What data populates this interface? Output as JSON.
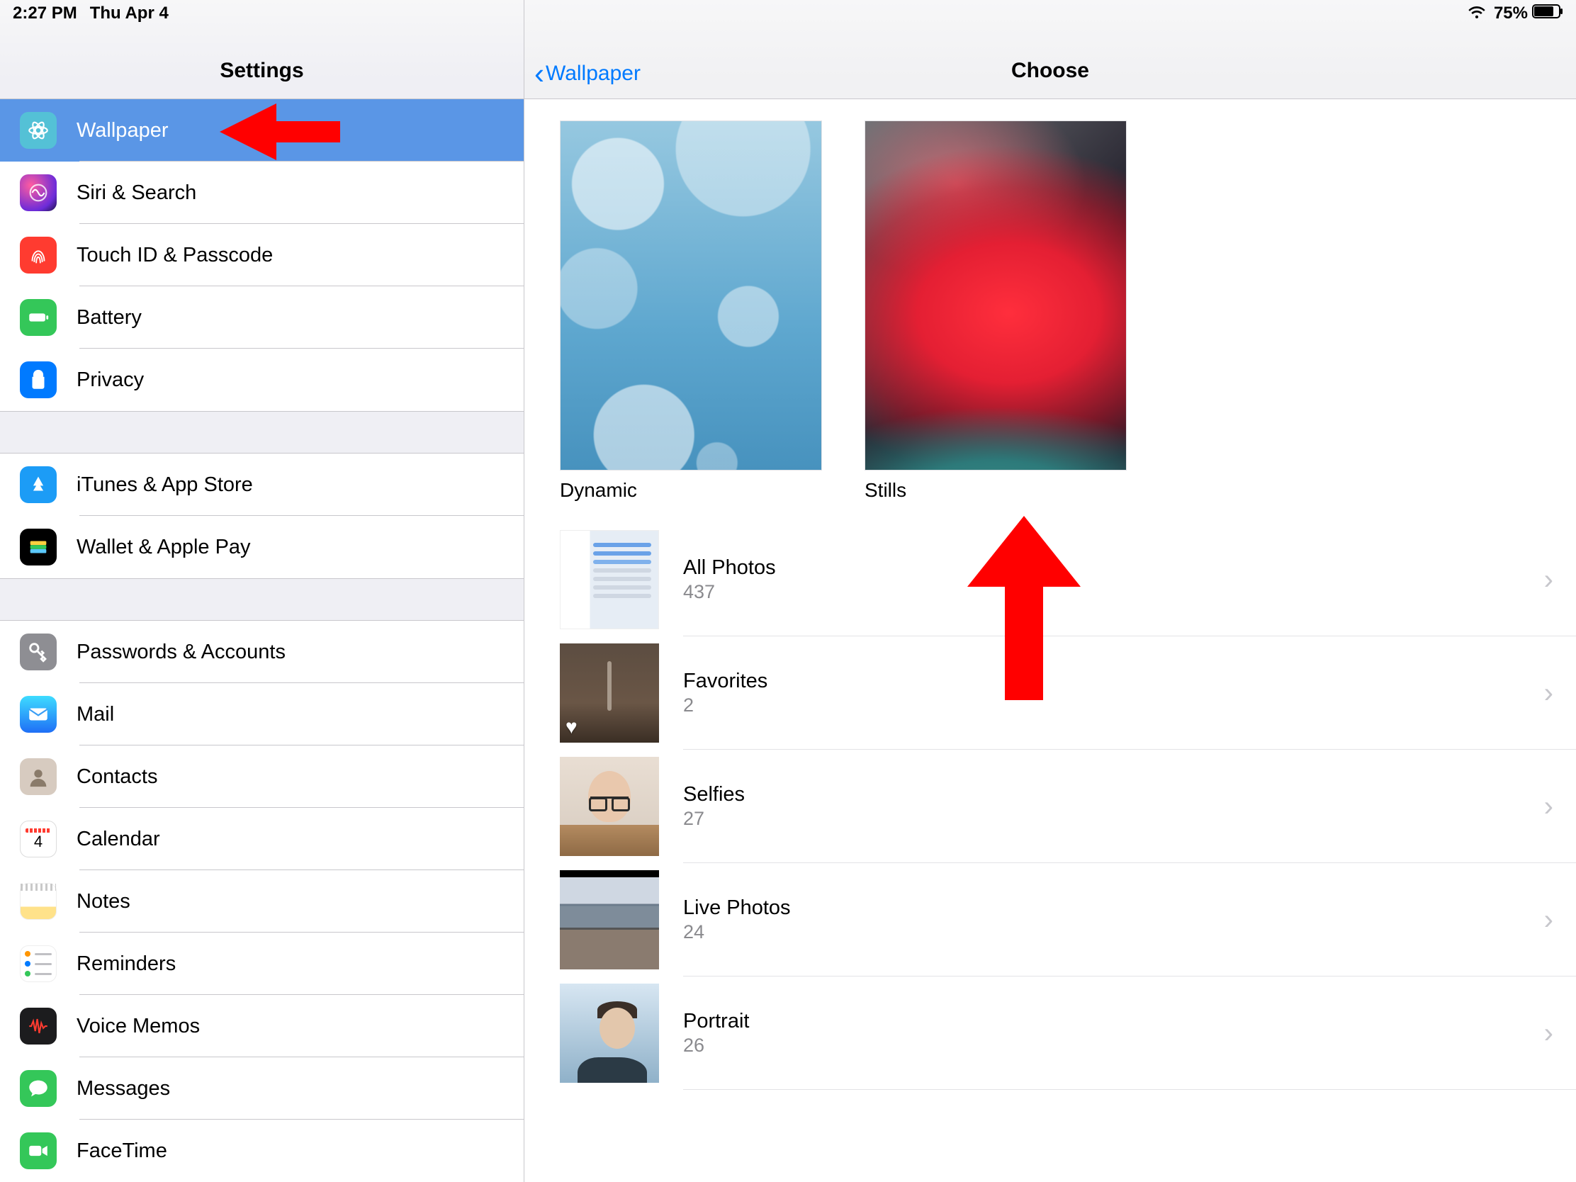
{
  "status": {
    "time": "2:27 PM",
    "date": "Thu Apr 4",
    "battery_pct": "75%"
  },
  "sidebar": {
    "title": "Settings",
    "groups": [
      [
        {
          "key": "wallpaper",
          "label": "Wallpaper",
          "icon": "wallpaper-icon",
          "selected": true
        },
        {
          "key": "siri",
          "label": "Siri & Search",
          "icon": "siri-icon"
        },
        {
          "key": "touchid",
          "label": "Touch ID & Passcode",
          "icon": "touchid-icon"
        },
        {
          "key": "battery",
          "label": "Battery",
          "icon": "battery-icon"
        },
        {
          "key": "privacy",
          "label": "Privacy",
          "icon": "privacy-icon"
        }
      ],
      [
        {
          "key": "itunes",
          "label": "iTunes & App Store",
          "icon": "appstore-icon"
        },
        {
          "key": "wallet",
          "label": "Wallet & Apple Pay",
          "icon": "wallet-icon"
        }
      ],
      [
        {
          "key": "passwords",
          "label": "Passwords & Accounts",
          "icon": "passwords-icon"
        },
        {
          "key": "mail",
          "label": "Mail",
          "icon": "mail-icon"
        },
        {
          "key": "contacts",
          "label": "Contacts",
          "icon": "contacts-icon"
        },
        {
          "key": "calendar",
          "label": "Calendar",
          "icon": "calendar-icon"
        },
        {
          "key": "notes",
          "label": "Notes",
          "icon": "notes-icon"
        },
        {
          "key": "reminders",
          "label": "Reminders",
          "icon": "reminders-icon"
        },
        {
          "key": "voicememos",
          "label": "Voice Memos",
          "icon": "voicememos-icon"
        },
        {
          "key": "messages",
          "label": "Messages",
          "icon": "messages-icon"
        },
        {
          "key": "facetime",
          "label": "FaceTime",
          "icon": "facetime-icon"
        }
      ]
    ]
  },
  "main": {
    "back_label": "Wallpaper",
    "title": "Choose",
    "wallpaper_types": [
      {
        "key": "dynamic",
        "label": "Dynamic"
      },
      {
        "key": "stills",
        "label": "Stills"
      }
    ],
    "albums": [
      {
        "key": "all",
        "title": "All Photos",
        "count": "437"
      },
      {
        "key": "favorites",
        "title": "Favorites",
        "count": "2"
      },
      {
        "key": "selfies",
        "title": "Selfies",
        "count": "27"
      },
      {
        "key": "live",
        "title": "Live Photos",
        "count": "24"
      },
      {
        "key": "portrait",
        "title": "Portrait",
        "count": "26"
      }
    ]
  },
  "annotations": {
    "arrow_color": "#ff0000"
  }
}
